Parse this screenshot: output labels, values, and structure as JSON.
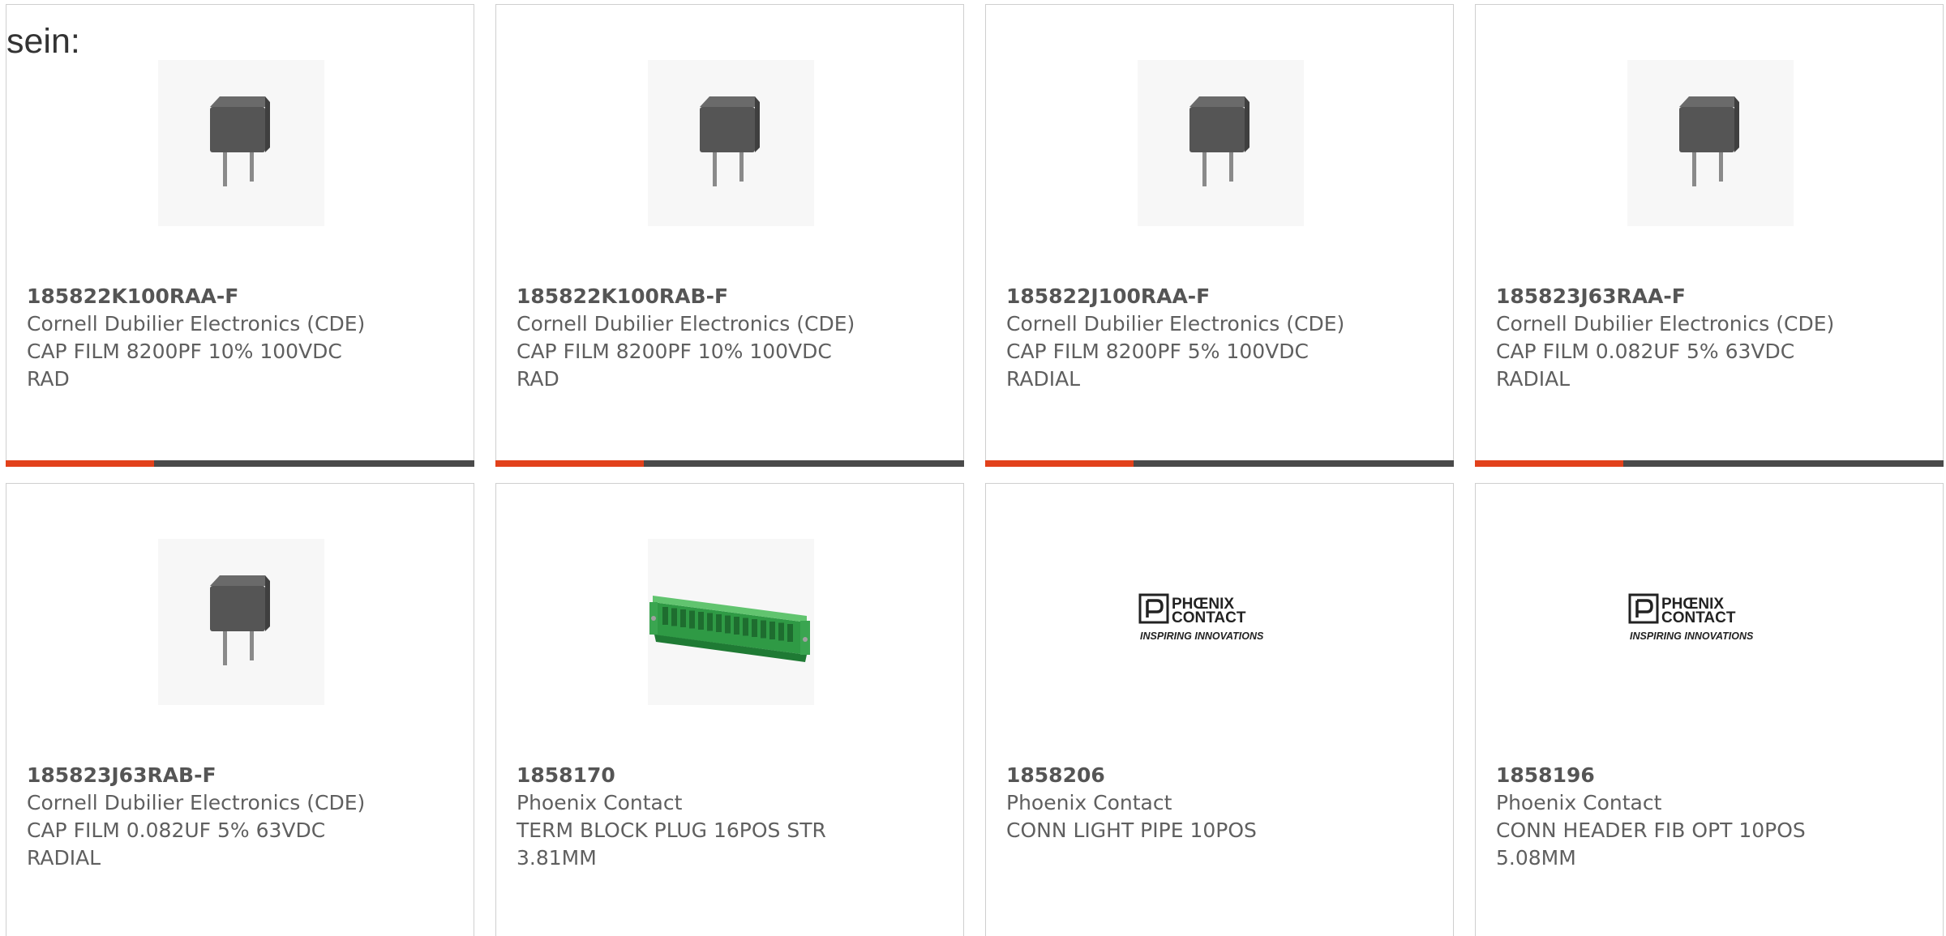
{
  "intro_text": "sein:",
  "colors": {
    "accent": "#e2411b",
    "bar": "#4a4a4a",
    "border": "#cfcfcf",
    "text": "#5f5f5f"
  },
  "products": [
    {
      "part_number": "185822K100RAA-F",
      "manufacturer": "Cornell Dubilier Electronics (CDE)",
      "description": "CAP FILM 8200PF 10% 100VDC RAD",
      "image": "film-capacitor-image"
    },
    {
      "part_number": "185822K100RAB-F",
      "manufacturer": "Cornell Dubilier Electronics (CDE)",
      "description": "CAP FILM 8200PF 10% 100VDC RAD",
      "image": "film-capacitor-image"
    },
    {
      "part_number": "185822J100RAA-F",
      "manufacturer": "Cornell Dubilier Electronics (CDE)",
      "description": "CAP FILM 8200PF 5% 100VDC RADIAL",
      "image": "film-capacitor-image"
    },
    {
      "part_number": "185823J63RAA-F",
      "manufacturer": "Cornell Dubilier Electronics (CDE)",
      "description": "CAP FILM 0.082UF 5% 63VDC RADIAL",
      "image": "film-capacitor-image"
    },
    {
      "part_number": "185823J63RAB-F",
      "manufacturer": "Cornell Dubilier Electronics (CDE)",
      "description": "CAP FILM 0.082UF 5% 63VDC RADIAL",
      "image": "film-capacitor-image"
    },
    {
      "part_number": "1858170",
      "manufacturer": "Phoenix Contact",
      "description": "TERM BLOCK PLUG 16POS STR 3.81MM",
      "image": "terminal-block-image"
    },
    {
      "part_number": "1858206",
      "manufacturer": "Phoenix Contact",
      "description": "CONN LIGHT PIPE 10POS",
      "image": "phoenix-contact-logo"
    },
    {
      "part_number": "1858196",
      "manufacturer": "Phoenix Contact",
      "description": "CONN HEADER FIB OPT 10POS 5.08MM",
      "image": "phoenix-contact-logo"
    }
  ],
  "logo": {
    "line1": "PHŒNIX",
    "line2": "CONTACT",
    "tagline": "INSPIRING INNOVATIONS"
  }
}
